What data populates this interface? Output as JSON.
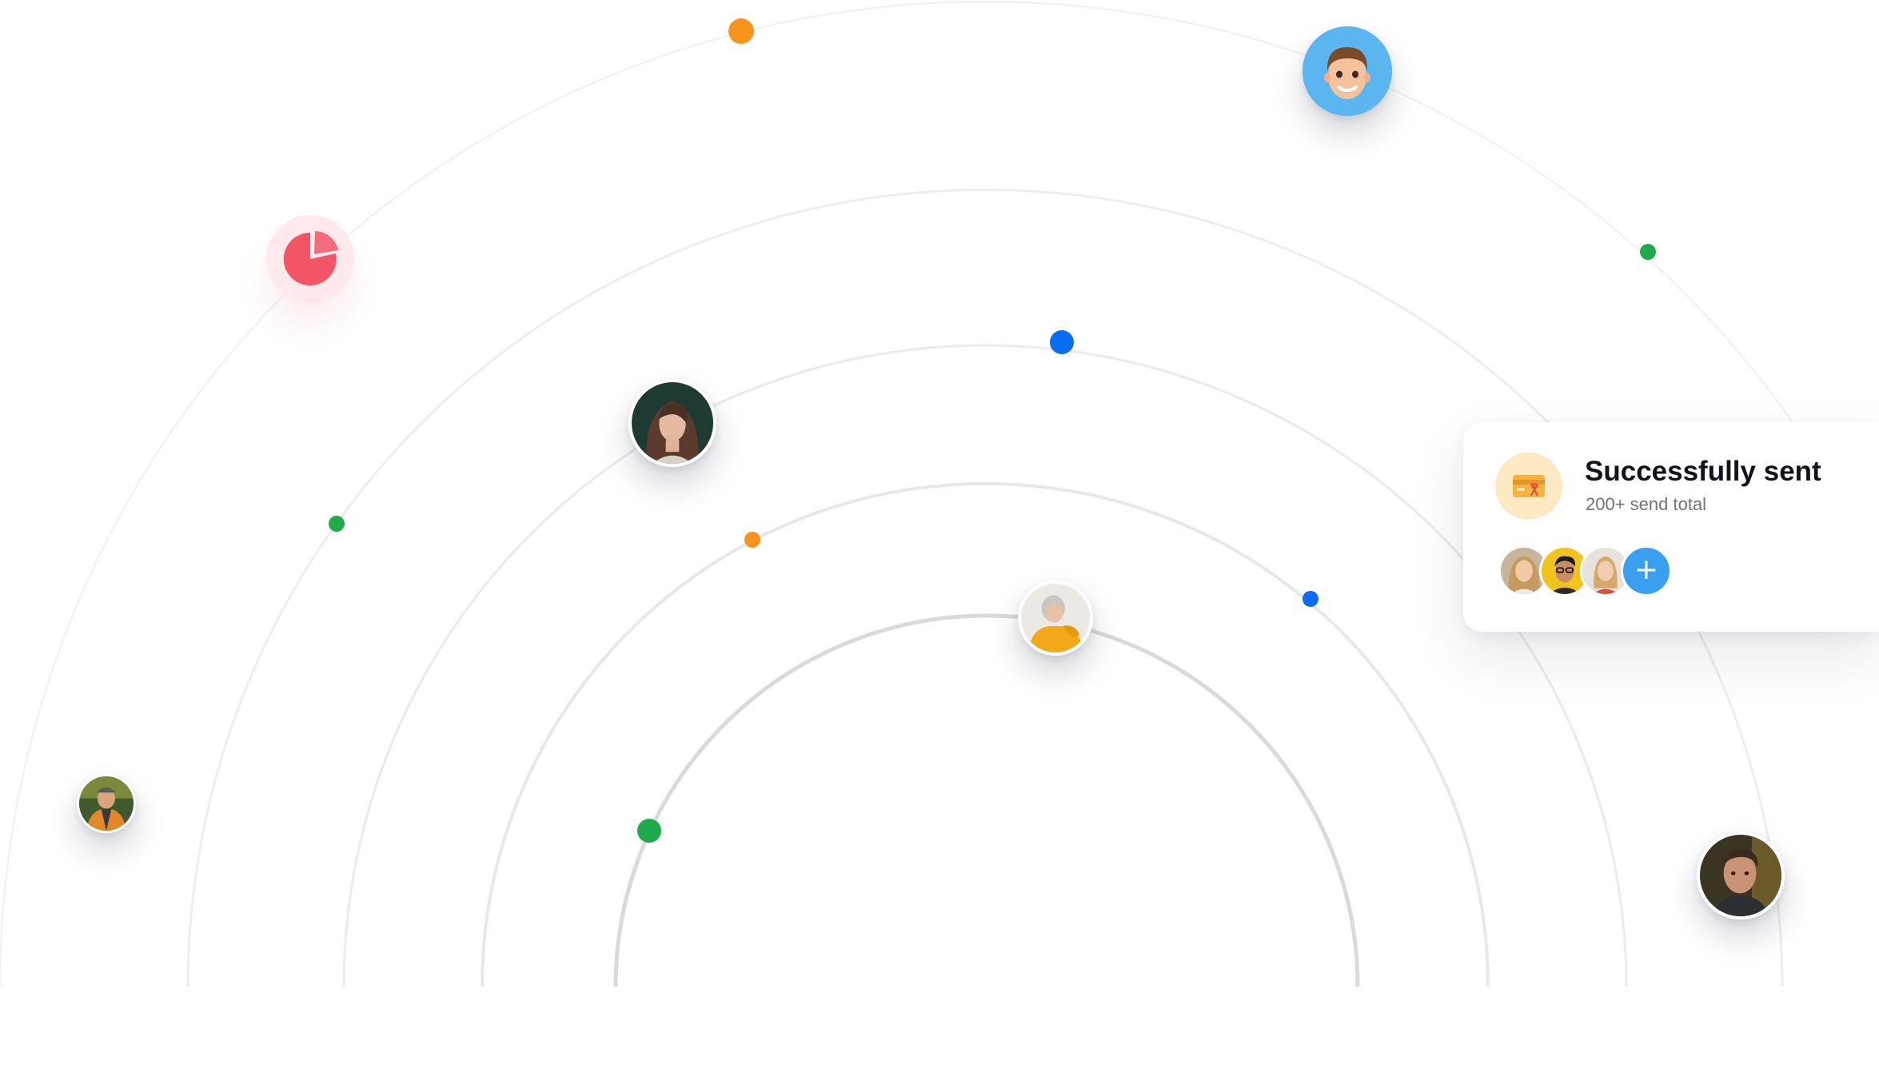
{
  "notification": {
    "title": "Successfully sent",
    "subtitle": "200+ send total",
    "icon": "gift-card-icon",
    "add_label": "+"
  },
  "colors": {
    "orbit": "#ececec",
    "orbit_inner": "#d9d9d9",
    "orange": "#f7941d",
    "green": "#1faa4b",
    "blue": "#0a6cf2",
    "pink": "#f25666",
    "accent_blue": "#3b9ff0"
  },
  "icons": [
    "pie-chart-icon",
    "gift-card-icon",
    "plus-icon"
  ]
}
